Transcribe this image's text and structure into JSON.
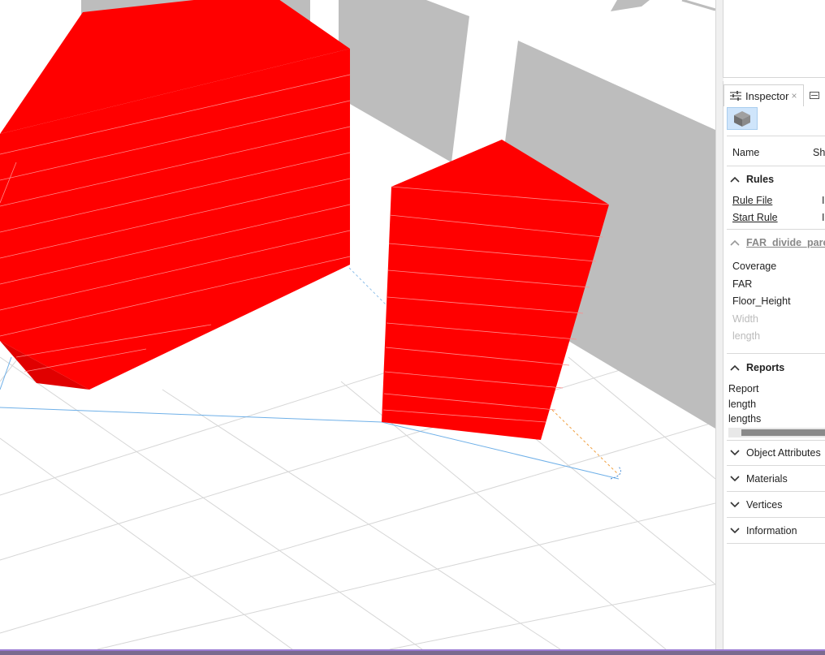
{
  "inspector": {
    "tab_label": "Inspector",
    "tab_close": "×",
    "name_label": "Name",
    "name_value": "Sha",
    "rules": {
      "title": "Rules",
      "rule_file_label": "Rule File",
      "start_rule_label": "Start Rule",
      "rule_file_value": "I",
      "start_rule_value": "I"
    },
    "attributes_group": {
      "title": "FAR_divide_parce",
      "items": [
        "Coverage",
        "FAR",
        "Floor_Height",
        "Width",
        "length"
      ]
    },
    "reports": {
      "title": "Reports",
      "items": [
        "Report",
        "length",
        "lengths"
      ]
    },
    "collapsed_sections": [
      "Object Attributes",
      "Materials",
      "Vertices",
      "Information"
    ]
  },
  "colors": {
    "building_fill": "#ff0000",
    "context_buildings": "#bdbdbd",
    "grid_lines": "#d6d6d6",
    "selection_line": "#6fb0e8",
    "accent_bar": "#9b7bd3"
  }
}
